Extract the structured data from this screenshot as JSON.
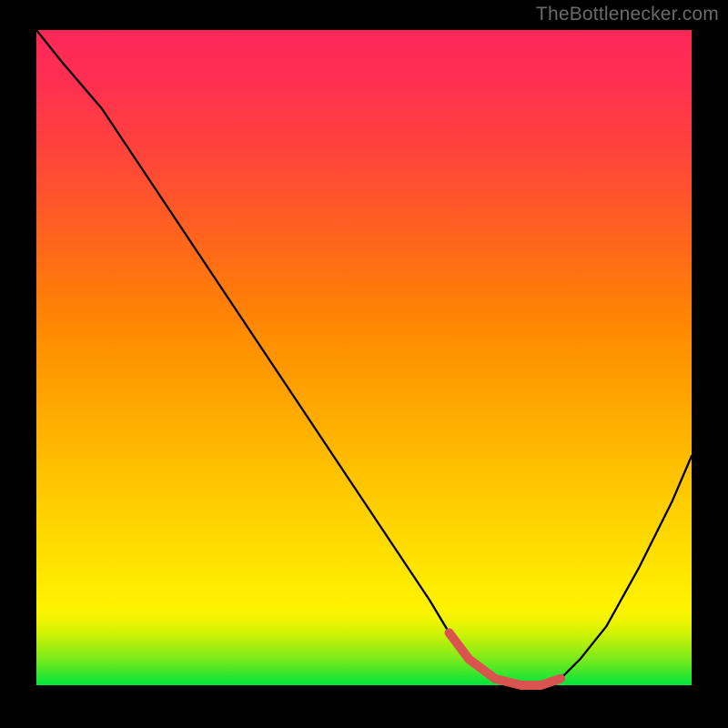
{
  "watermark": "TheBottlenecker.com",
  "chart_data": {
    "type": "line",
    "title": "",
    "xlabel": "",
    "ylabel": "",
    "xlim": [
      0,
      100
    ],
    "ylim": [
      0,
      100
    ],
    "series": [
      {
        "name": "main-curve",
        "color": "#000000",
        "x": [
          0,
          4,
          10,
          20,
          30,
          40,
          50,
          60,
          63,
          66,
          70,
          74,
          77,
          80,
          83,
          87,
          92,
          97,
          100
        ],
        "values": [
          100,
          95,
          88,
          73,
          58,
          43,
          28,
          13,
          8,
          4,
          1,
          0,
          0,
          1,
          4,
          9,
          18,
          28,
          35
        ]
      },
      {
        "name": "bottom-highlight",
        "color": "#d9544f",
        "x": [
          63,
          66,
          70,
          74,
          77,
          80
        ],
        "values": [
          8,
          4,
          1,
          0,
          0,
          1
        ]
      }
    ],
    "gradient_stops": [
      {
        "pct": 0,
        "color": "#00e53d"
      },
      {
        "pct": 10,
        "color": "#f1f502"
      },
      {
        "pct": 14,
        "color": "#ffee00"
      },
      {
        "pct": 40,
        "color": "#ffae00"
      },
      {
        "pct": 70,
        "color": "#ff6320"
      },
      {
        "pct": 100,
        "color": "#ff2759"
      }
    ]
  }
}
